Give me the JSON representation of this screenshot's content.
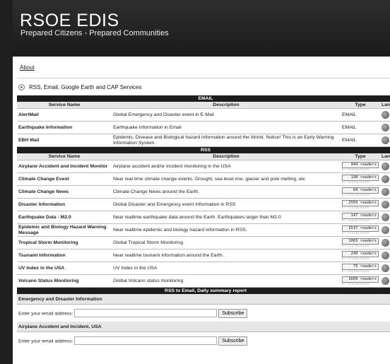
{
  "header": {
    "title": "RSOE EDIS",
    "subtitle": "Prepared Citizens - Prepared Communities"
  },
  "nav": {
    "about": "About"
  },
  "services_title": "RSS, Email, Google Earth and CAP Services",
  "columns": {
    "name": "Service Name",
    "desc": "Description",
    "type": "Type",
    "lang": "Lang"
  },
  "email_section": "EMAIL",
  "email_rows": [
    {
      "name": "AlertMail",
      "desc": "Global Emergency and Disaster event in E-Mail",
      "type": "EMAIL"
    },
    {
      "name": "Earthquake Information",
      "desc": "Earthquake Information in Email",
      "type": "EMAIL"
    },
    {
      "name": "EBH Mail",
      "desc": "Epidemic, Disease and Biological hazard information around the World. Notice! This is an Early Warning Information System.",
      "type": "EMAIL"
    }
  ],
  "rss_section": "RSS",
  "rss_rows": [
    {
      "name": "Airplane Accident and Incident Monitor",
      "desc": "Airplane accident and/or incident monitoring in the USA",
      "readers": "944 readers"
    },
    {
      "name": "Climate Change Event",
      "desc": "Near real time climate change events. Drought, sea level rise, glacier and pole melting, etc",
      "readers": "198 readers"
    },
    {
      "name": "Climate Change News",
      "desc": "Climate Change News around the Earth.",
      "readers": "84 readers"
    },
    {
      "name": "Disaster Information",
      "desc": "Global Disaster and Emergency event Information in RSS",
      "readers": "2503 readers"
    },
    {
      "name": "Earthquake Data - M2.0",
      "desc": "Near realtime earthquake data around the Earth. Earthquakes larger than M2.0",
      "readers": "147 readers"
    },
    {
      "name": "Epidemic and Biology Hazard Warning Message",
      "desc": "Near realtime epidemic and biology hazard information in RSS.",
      "readers": "1537 readers"
    },
    {
      "name": "Tropical Storm Monitoring",
      "desc": "Global Tropical Storm Monitoring",
      "readers": "1063 readers"
    },
    {
      "name": "Tsunami Information",
      "desc": "Near realtime tsunami information around the Earth.",
      "readers": "249 readers"
    },
    {
      "name": "UV Index in the USA",
      "desc": "UV Index in the USA",
      "readers": "75 readers"
    },
    {
      "name": "Volcano Status Monitoring",
      "desc": "Global Volcano status monitoring",
      "readers": "1609 readers"
    }
  ],
  "feedburner": "BY FEEDBURNER",
  "daily_section": "RSS to Email, Daily summary report",
  "forms": [
    {
      "title": "Emergency and Disaster Information",
      "label": "Enter your email address:",
      "button": "Subscribe"
    },
    {
      "title": "Airplane Accident and Incident, USA",
      "label": "Enter your email address:",
      "button": "Subscribe"
    }
  ]
}
